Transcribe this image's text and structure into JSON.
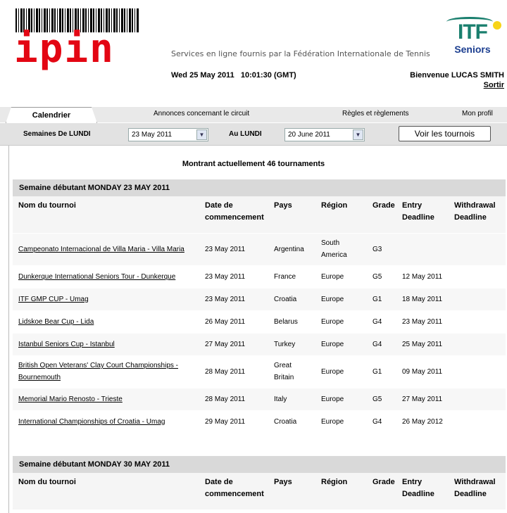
{
  "header": {
    "logo_text": "ipin",
    "services": "Services en ligne fournis par la Fédération Internationale de Tennis",
    "itf_text": "ITF",
    "itf_sub": "Seniors",
    "datetime": "Wed 25 May 2011   10:01:30 (GMT)",
    "welcome": "Bienvenue LUCAS SMITH",
    "logout": "Sortir"
  },
  "tabs": {
    "calendar": "Calendrier",
    "announcements": "Annonces concernant le circuit",
    "rules": "Règles et règlements",
    "profile": "Mon profil"
  },
  "filters": {
    "from_label": "Semaines De LUNDI",
    "from_value": "23 May 2011",
    "to_label": "Au LUNDI",
    "to_value": "20 June 2011",
    "button": "Voir les tournois"
  },
  "showing": "Montrant actuellement 46 tournaments",
  "columns": {
    "name": "Nom du tournoi",
    "date": "Date de commencement",
    "pays": "Pays",
    "region": "Région",
    "grade": "Grade",
    "entry": "Entry Deadline",
    "withdrawal": "Withdrawal Deadline"
  },
  "weeks": [
    {
      "title": "Semaine débutant MONDAY 23 MAY 2011",
      "rows": [
        {
          "name": "Campeonato Internacional de Villa Maria - Villa Maria",
          "date": "23 May 2011",
          "pays": "Argentina",
          "region": "South America",
          "grade": "G3",
          "entry": "",
          "withdrawal": ""
        },
        {
          "name": "Dunkerque International Seniors Tour - Dunkerque",
          "date": "23 May 2011",
          "pays": "France",
          "region": "Europe",
          "grade": "G5",
          "entry": "12 May 2011",
          "withdrawal": ""
        },
        {
          "name": "ITF GMP CUP - Umag",
          "date": "23 May 2011",
          "pays": "Croatia",
          "region": "Europe",
          "grade": "G1",
          "entry": "18 May 2011",
          "withdrawal": ""
        },
        {
          "name": "Lidskoe Bear Cup - Lida",
          "date": "26 May 2011",
          "pays": "Belarus",
          "region": "Europe",
          "grade": "G4",
          "entry": "23 May 2011",
          "withdrawal": ""
        },
        {
          "name": "Istanbul Seniors Cup - Istanbul",
          "date": "27 May 2011",
          "pays": "Turkey",
          "region": "Europe",
          "grade": "G4",
          "entry": "25 May 2011",
          "withdrawal": ""
        },
        {
          "name": "British Open Veterans' Clay Court Championships - Bournemouth",
          "date": "28 May 2011",
          "pays": "Great Britain",
          "region": "Europe",
          "grade": "G1",
          "entry": "09 May 2011",
          "withdrawal": ""
        },
        {
          "name": "Memorial Mario Renosto - Trieste",
          "date": "28 May 2011",
          "pays": "Italy",
          "region": "Europe",
          "grade": "G5",
          "entry": "27 May 2011",
          "withdrawal": ""
        },
        {
          "name": "International Championships of Croatia - Umag",
          "date": "29 May 2011",
          "pays": "Croatia",
          "region": "Europe",
          "grade": "G4",
          "entry": "26 May 2012",
          "withdrawal": ""
        }
      ]
    },
    {
      "title": "Semaine débutant MONDAY 30 MAY 2011",
      "rows": []
    }
  ]
}
